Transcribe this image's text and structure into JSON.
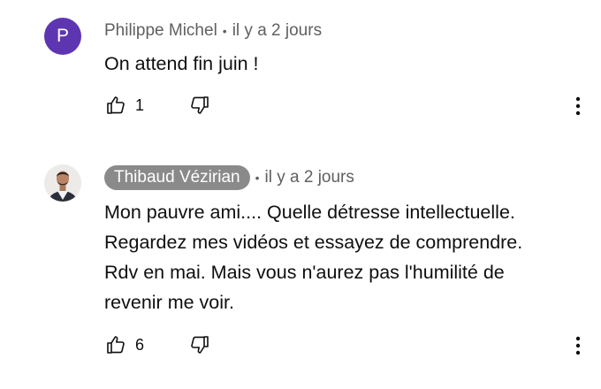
{
  "comments": [
    {
      "avatar_letter": "P",
      "author": "Philippe Michel",
      "separator": "•",
      "time": "il y a 2 jours",
      "text": "On attend fin juin !",
      "likes": "1",
      "icons": {
        "like": "thumbs-up-icon",
        "dislike": "thumbs-down-icon",
        "more": "more-vertical-icon"
      }
    },
    {
      "avatar_desc": "profile-photo",
      "author": "Thibaud Vézirian",
      "separator": "•",
      "time": "il y a 2 jours",
      "text_lines": [
        "Mon pauvre ami.... Quelle détresse intellectuelle.",
        "Regardez mes vidéos et essayez de comprendre.",
        "Rdv en mai. Mais vous n'aurez pas l'humilité de",
        "revenir me voir."
      ],
      "likes": "6",
      "icons": {
        "like": "thumbs-up-icon",
        "dislike": "thumbs-down-icon",
        "more": "more-vertical-icon"
      }
    }
  ],
  "colors": {
    "avatar_p": "#5e35b1",
    "author_chip": "#8a8a8a",
    "meta_text": "#606060",
    "body_text": "#0f0f0f"
  }
}
